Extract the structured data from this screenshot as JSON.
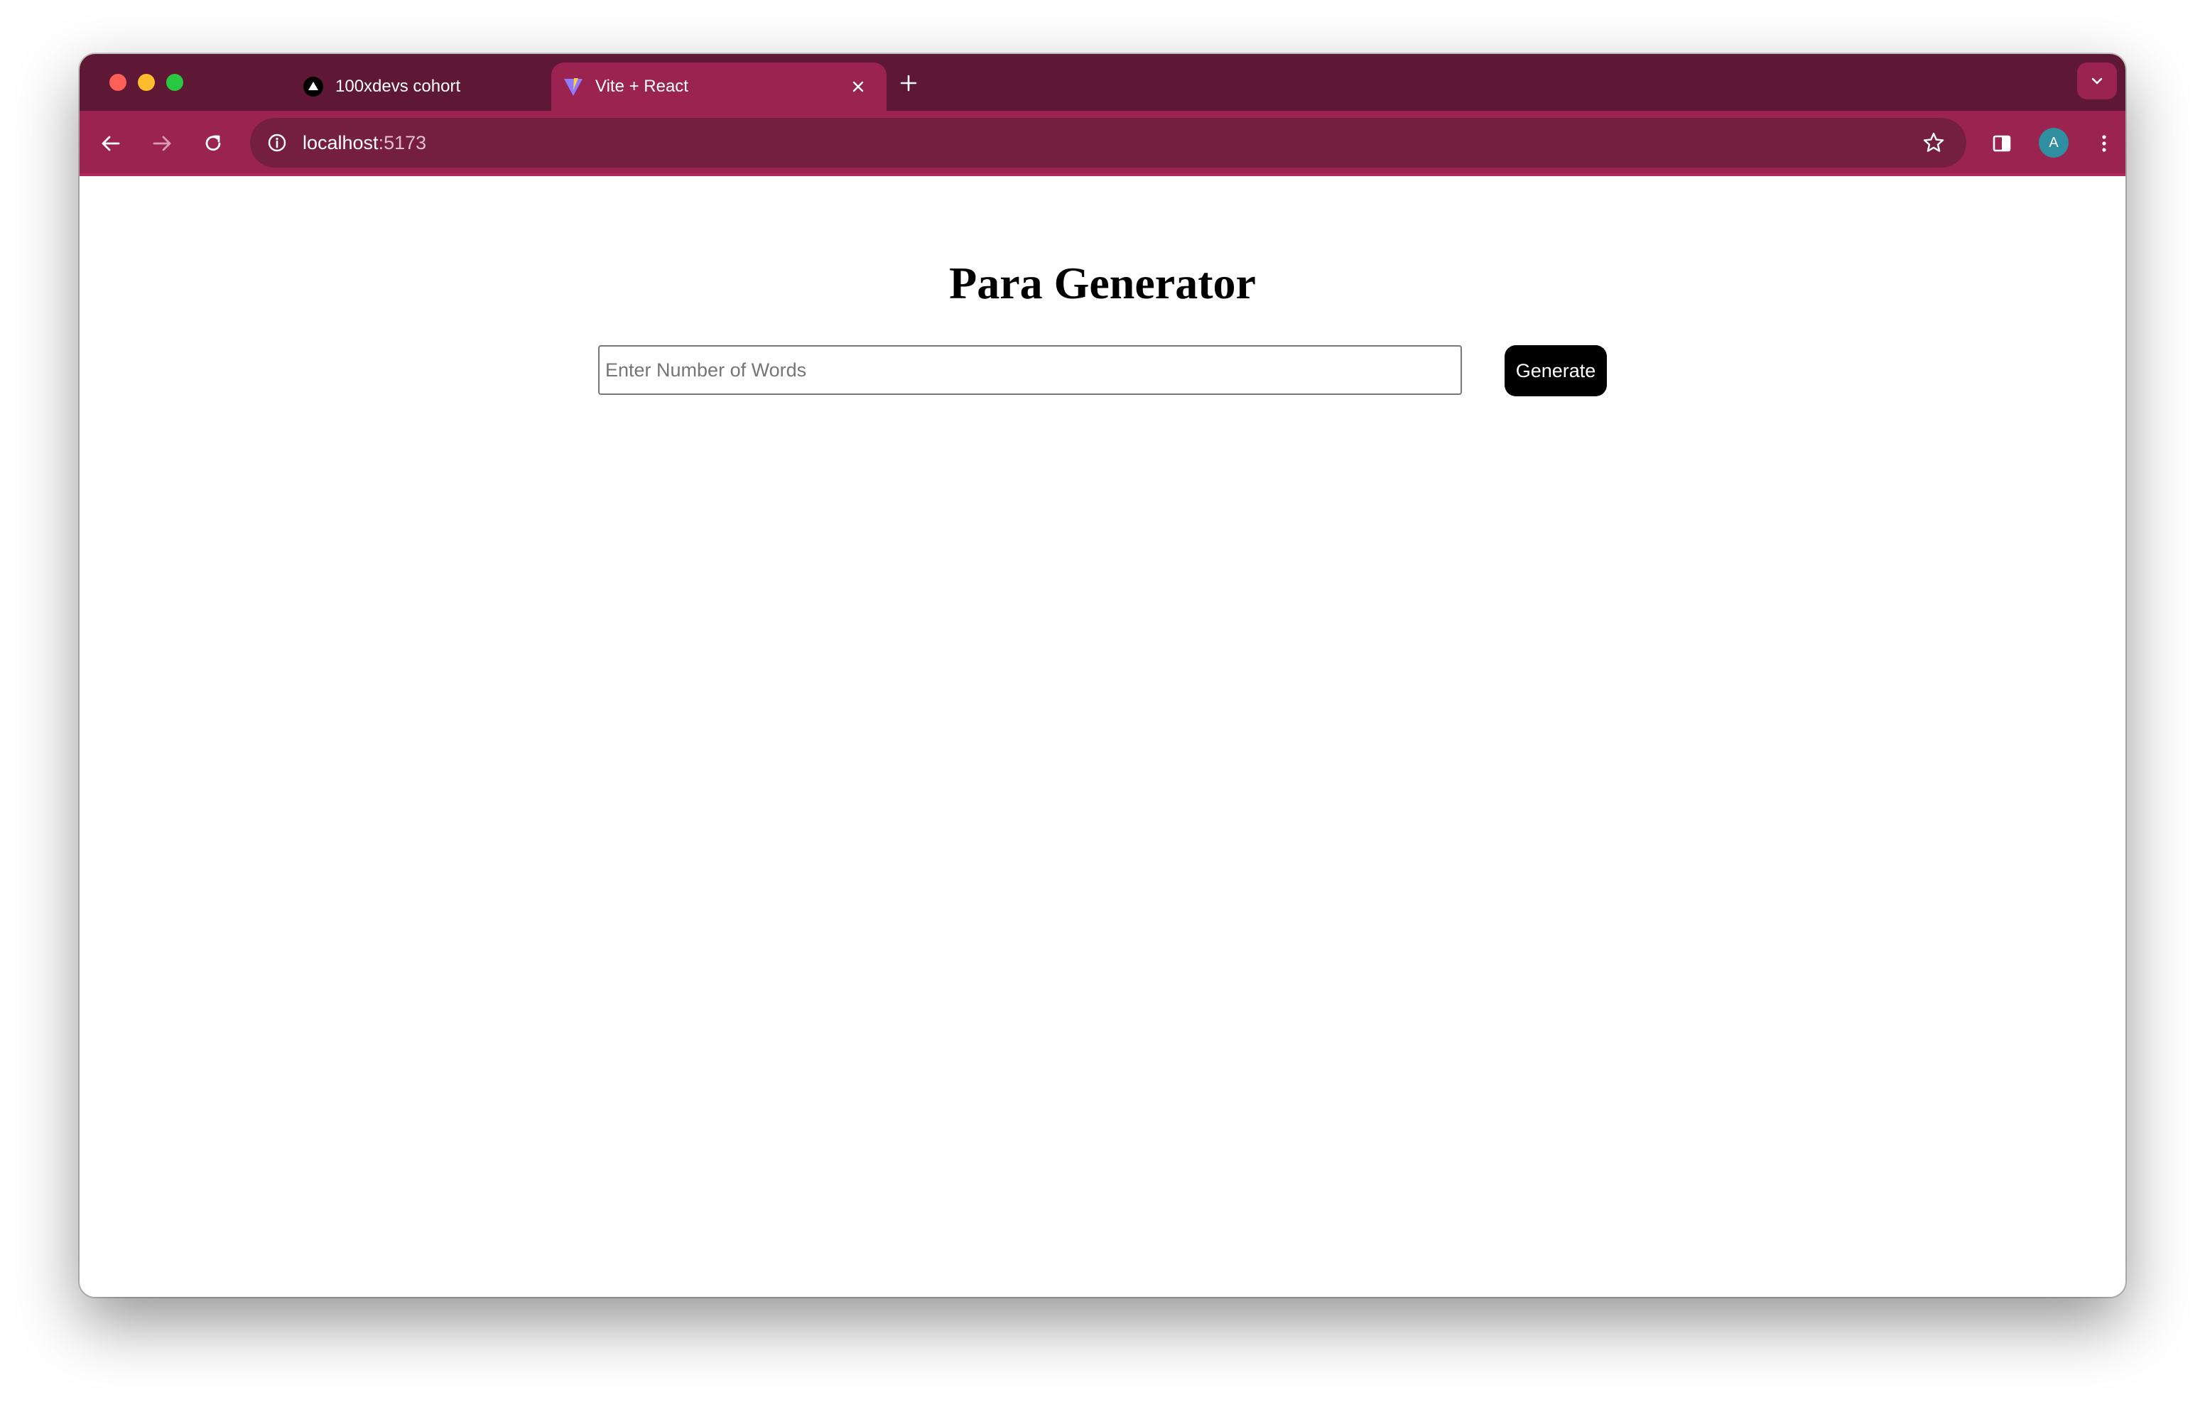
{
  "tabs": [
    {
      "title": "100xdevs cohort",
      "favicon": "triangle-logo-icon",
      "active": false
    },
    {
      "title": "Vite + React",
      "favicon": "vite-logo-icon",
      "active": true
    }
  ],
  "address_bar": {
    "host": "localhost",
    "port": ":5173"
  },
  "profile": {
    "initial": "A",
    "color": "#2f8fa0"
  },
  "theme": {
    "frame": "#5e1734",
    "toolbar": "#9a234f",
    "omnibox": "#751f40"
  },
  "page": {
    "title": "Para Generator",
    "input_placeholder": "Enter Number of Words",
    "input_value": "",
    "generate_label": "Generate"
  }
}
